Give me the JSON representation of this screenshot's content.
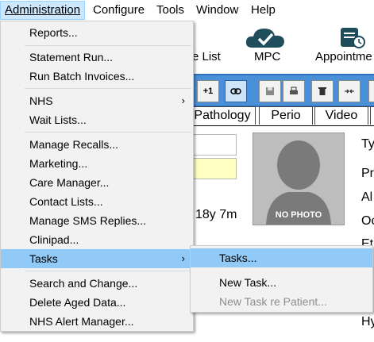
{
  "menubar": {
    "items": [
      "Administration",
      "Configure",
      "Tools",
      "Window",
      "Help"
    ]
  },
  "toolbar": {
    "partial_label": "e List",
    "mpc_label": "MPC",
    "appointments_label": "Appointme"
  },
  "toolbar_buttons": {
    "plus_one": "+1"
  },
  "tabs": [
    "Pathology",
    "Perio",
    "Video"
  ],
  "patient": {
    "age": "18y 7m",
    "photo_text": "NO PHOTO"
  },
  "right_labels": [
    "Ty",
    "Pr",
    "Al",
    "Oc",
    "Et",
    "Hy"
  ],
  "admin_menu": {
    "items": [
      {
        "label": "Reports..."
      },
      {
        "label": "Statement Run..."
      },
      {
        "label": "Run Batch Invoices..."
      },
      {
        "label": "NHS",
        "submenu": true
      },
      {
        "label": "Wait Lists..."
      },
      {
        "label": "Manage Recalls..."
      },
      {
        "label": "Marketing..."
      },
      {
        "label": "Care Manager..."
      },
      {
        "label": "Contact Lists..."
      },
      {
        "label": "Manage SMS Replies..."
      },
      {
        "label": "Clinipad..."
      },
      {
        "label": "Tasks",
        "submenu": true,
        "highlighted": true
      },
      {
        "label": "Search and Change..."
      },
      {
        "label": "Delete Aged Data..."
      },
      {
        "label": "NHS Alert Manager..."
      }
    ]
  },
  "tasks_submenu": {
    "items": [
      {
        "label": "Tasks...",
        "highlighted": true
      },
      {
        "label": "New Task..."
      },
      {
        "label": "New Task re Patient...",
        "disabled": true
      }
    ]
  },
  "colors": {
    "highlight": "#91c9f7",
    "menu_bg": "#f2f2f2",
    "toolbar_blue": "#4a90d9",
    "menubar_active": "#cce8ff"
  },
  "icons": [
    "cloud-check-icon",
    "calendar-clock-icon",
    "link-icon",
    "save-icon",
    "print-icon",
    "trash-icon",
    "merge-arrows-icon",
    "chevron-right-icon"
  ]
}
